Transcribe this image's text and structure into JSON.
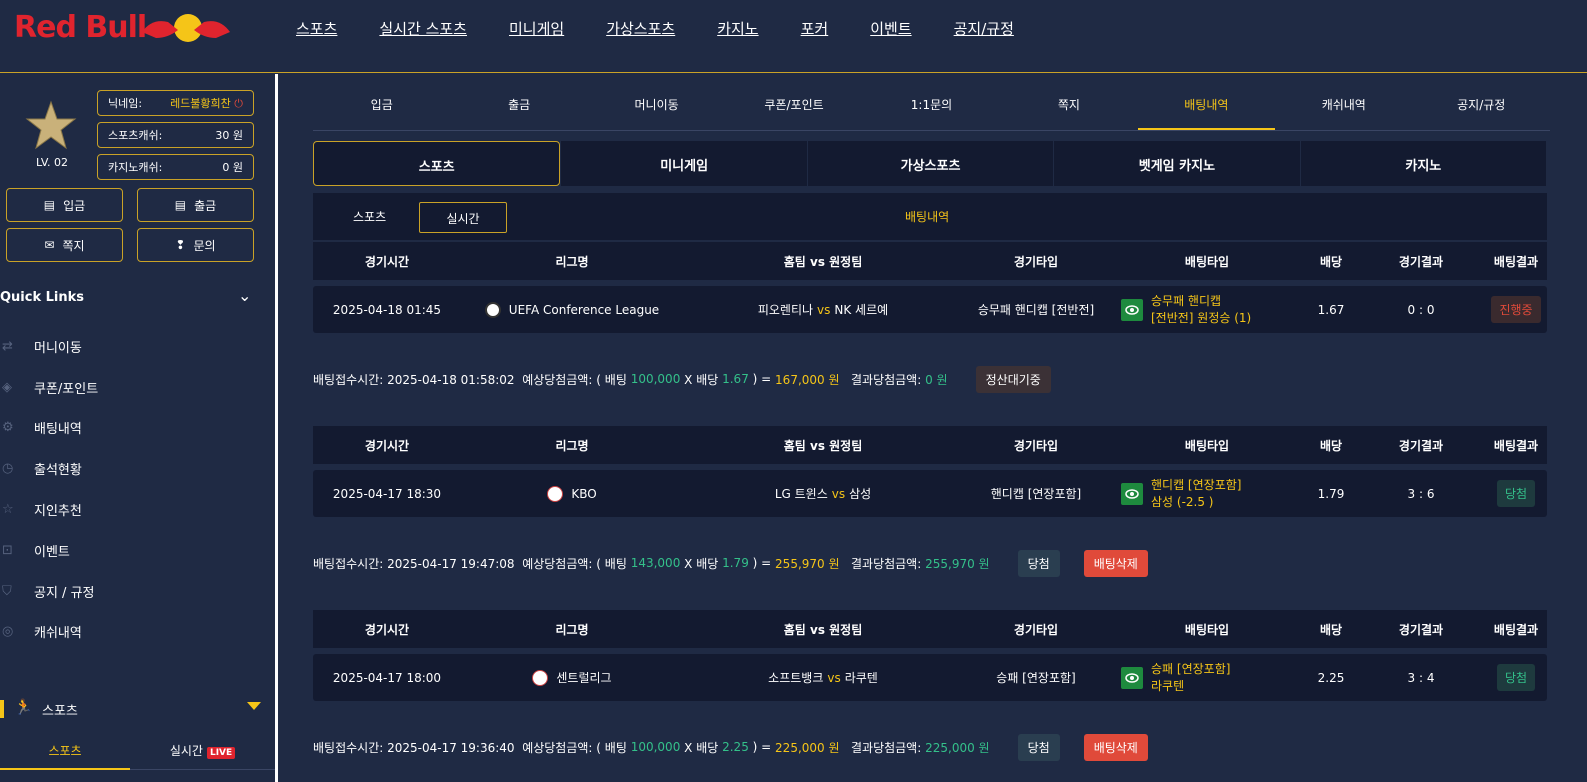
{
  "brand": {
    "logo_text": "Red Bull"
  },
  "nav": [
    "스포츠",
    "실시간 스포츠",
    "미니게임",
    "가상스포츠",
    "카지노",
    "포커",
    "이벤트",
    "공지/규정"
  ],
  "profile": {
    "level": "LV. 02",
    "nickname_label": "닉네임:",
    "nickname": "레드불황희찬",
    "sports_cash_label": "스포츠캐쉬:",
    "sports_cash": "30 원",
    "casino_cash_label": "카지노캐쉬:",
    "casino_cash": "0 원"
  },
  "side_buttons": {
    "deposit": "입금",
    "withdraw": "출금",
    "message": "쪽지",
    "inquiry": "문의"
  },
  "quick_links": {
    "title": "Quick Links",
    "items": [
      "머니이동",
      "쿠폰/포인트",
      "배팅내역",
      "출석현황",
      "지인추천",
      "이벤트",
      "공지 / 규정",
      "캐쉬내역"
    ]
  },
  "sidebar_sports": {
    "label": "스포츠",
    "tab1": "스포츠",
    "tab2": "실시간",
    "live": "LIVE"
  },
  "tabs1": [
    "입금",
    "출금",
    "머니이동",
    "쿠폰/포인트",
    "1:1문의",
    "쪽지",
    "배팅내역",
    "캐쉬내역",
    "공지/규정"
  ],
  "tabs2": [
    "스포츠",
    "미니게임",
    "가상스포츠",
    "벳게임 카지노",
    "카지노"
  ],
  "sub": {
    "s1": "스포츠",
    "s2": "실시간",
    "title": "배팅내역"
  },
  "columns": [
    "경기시간",
    "리그명",
    "홈팀 vs 원정팀",
    "경기타입",
    "배팅타입",
    "배당",
    "경기결과",
    "배팅결과"
  ],
  "vs": "vs",
  "bets": [
    {
      "time": "2025-04-18 01:45",
      "league": "UEFA Conference League",
      "home": "피오렌티나",
      "away": "NK 세르예",
      "type": "승무패 핸디캡 [전반전]",
      "bet_line1": "승무패 핸디캡",
      "bet_line2": "[전반전] 원정승 (1)",
      "odds": "1.67",
      "score": "0 : 0",
      "result": "진행중",
      "sum_time": "배팅접수시간: 2025-04-18 01:58:02",
      "sum_exp_label": "예상당첨금액: ( 배팅",
      "sum_stake": "100,000",
      "sum_x": "X 배당",
      "sum_odds": "1.67",
      "sum_eq": ") =",
      "sum_expected": "167,000 원",
      "sum_res_label": "결과당첨금액:",
      "sum_result": "0 원",
      "status": "정산대기중"
    },
    {
      "time": "2025-04-17 18:30",
      "league": "KBO",
      "home": "LG 트윈스",
      "away": "삼성",
      "type": "핸디캡 [연장포함]",
      "bet_line1": "핸디캡 [연장포함]",
      "bet_line2": "삼성 (-2.5 )",
      "odds": "1.79",
      "score": "3 : 6",
      "result": "당첨",
      "sum_time": "배팅접수시간: 2025-04-17 19:47:08",
      "sum_exp_label": "예상당첨금액: ( 배팅",
      "sum_stake": "143,000",
      "sum_x": "X 배당",
      "sum_odds": "1.79",
      "sum_eq": ") =",
      "sum_expected": "255,970 원",
      "sum_res_label": "결과당첨금액:",
      "sum_result": "255,970 원",
      "status": "당첨",
      "delete": "배팅삭제"
    },
    {
      "time": "2025-04-17 18:00",
      "league": "센트럴리그",
      "home": "소프트뱅크",
      "away": "라쿠텐",
      "type": "승패 [연장포함]",
      "bet_line1": "승패 [연장포함]",
      "bet_line2": "라쿠텐",
      "odds": "2.25",
      "score": "3 : 4",
      "result": "당첨",
      "sum_time": "배팅접수시간: 2025-04-17 19:36:40",
      "sum_exp_label": "예상당첨금액: ( 배팅",
      "sum_stake": "100,000",
      "sum_x": "X 배당",
      "sum_odds": "2.25",
      "sum_eq": ") =",
      "sum_expected": "225,000 원",
      "sum_res_label": "결과당첨금액:",
      "sum_result": "225,000 원",
      "status": "당첨",
      "delete": "배팅삭제"
    }
  ]
}
